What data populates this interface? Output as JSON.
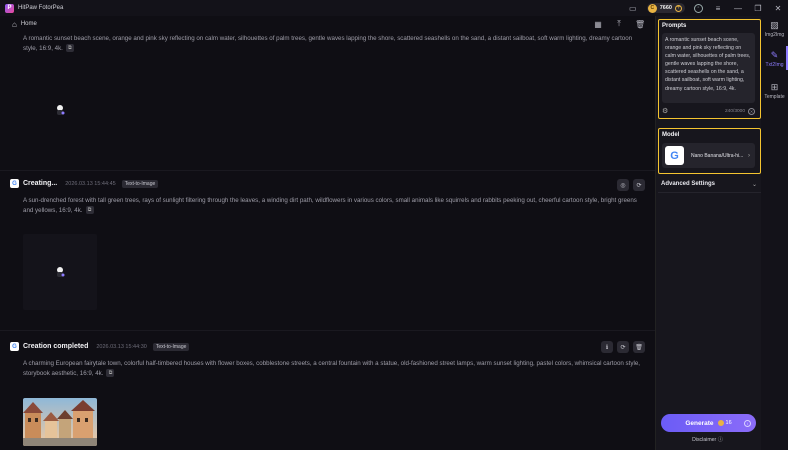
{
  "app": {
    "title": "HitPaw FotorPea",
    "credits": "7660"
  },
  "nav": {
    "home_label": "Home"
  },
  "feed": {
    "items": [
      {
        "status": "",
        "timestamp": "",
        "tag": "",
        "prompt": "A romantic sunset beach scene, orange and pink sky reflecting on calm water, silhouettes of palm trees, gentle waves lapping the shore, scattered seashells on the sand, a distant sailboat, soft warm lighting, dreamy cartoon style, 16:9, 4k."
      },
      {
        "status": "Creating...",
        "timestamp": "2026.03.13 15:44:45",
        "tag": "Text-to-Image",
        "prompt": "A sun-drenched forest with tall green trees, rays of sunlight filtering through the leaves, a winding dirt path, wildflowers in various colors, small animals like squirrels and rabbits peeking out, cheerful cartoon style, bright greens and yellows, 16:9, 4k."
      },
      {
        "status": "Creation completed",
        "timestamp": "2026.03.13 15:44:30",
        "tag": "Text-to-Image",
        "prompt": "A charming European fairytale town, colorful half-timbered houses with flower boxes, cobblestone streets, a central fountain with a statue, old-fashioned street lamps, warm sunset lighting, pastel colors, whimsical cartoon style, storybook aesthetic, 16:9, 4k."
      }
    ]
  },
  "panel": {
    "prompts_title": "Prompts",
    "prompt_value": "A romantic sunset beach scene, orange and pink sky reflecting on calm water, silhouettes of palm trees, gentle waves lapping the shore, scattered seashells on the sand, a distant sailboat, soft warm lighting, dreamy cartoon style, 16:9, 4k.",
    "char_count": "240/3000",
    "model_title": "Model",
    "model_name": "Nano Banana/Ultra-hi...",
    "advanced_label": "Advanced Settings",
    "generate_label": "Generate",
    "generate_cost": "16",
    "disclaimer": "Disclaimer"
  },
  "rail": {
    "items": [
      {
        "label": "Img2Img"
      },
      {
        "label": "Txt2Img"
      },
      {
        "label": "Template"
      }
    ]
  },
  "colors": {
    "accent": "#8e7cff",
    "highlight": "#f4c430",
    "coin": "#e8b343"
  }
}
